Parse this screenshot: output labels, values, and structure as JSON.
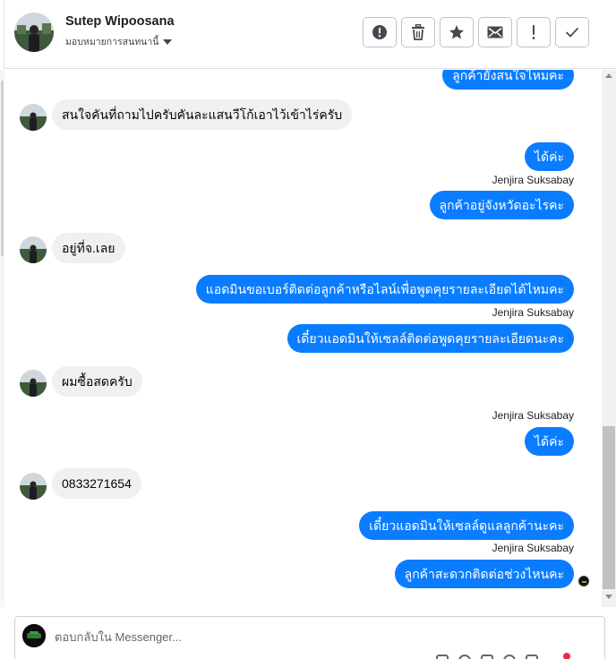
{
  "header": {
    "contact_name": "Sutep Wipoosana",
    "assign_label": "มอบหมายการสนทนานี้"
  },
  "actions": [
    {
      "icon": "alert-circle-icon"
    },
    {
      "icon": "trash-icon"
    },
    {
      "icon": "star-icon"
    },
    {
      "icon": "mail-icon"
    },
    {
      "icon": "exclamation-icon"
    },
    {
      "icon": "check-icon"
    }
  ],
  "messages": [
    {
      "dir": "out",
      "text": "ลูกค้ายังสนใจไหมคะ"
    },
    {
      "dir": "in",
      "text": "สนใจคันที่ถามไปครับคันละแสนวีโก้เอาไว้เข้าไร่ครับ"
    },
    {
      "dir": "out",
      "text": "ได้ค่ะ"
    },
    {
      "dir": "out",
      "sender": "Jenjira Suksabay",
      "text": "ลูกค้าอยู่จังหวัดอะไรคะ"
    },
    {
      "dir": "in",
      "text": "อยู่ที่จ.เลย"
    },
    {
      "dir": "out",
      "text": "แอดมินขอเบอร์ติดต่อลูกค้าหรือไลน์เพื่อพูดคุยรายละเอียดได้ไหมคะ"
    },
    {
      "dir": "out",
      "sender": "Jenjira Suksabay",
      "text": "เดี๋ยวแอดมินให้เซลล์ติดต่อพูดคุยรายละเอียดนะคะ"
    },
    {
      "dir": "in",
      "text": "ผมซื้อสดครับ"
    },
    {
      "dir": "out",
      "sender": "Jenjira Suksabay",
      "text": "ได้ค่ะ"
    },
    {
      "dir": "in",
      "text": "0833271654"
    },
    {
      "dir": "out",
      "text": "เดี๋ยวแอดมินให้เซลล์ดูแลลูกค้านะคะ"
    },
    {
      "dir": "out",
      "sender": "Jenjira Suksabay",
      "text": "ลูกค้าสะดวกติดต่อช่วงไหนคะ"
    }
  ],
  "composer": {
    "placeholder": "ตอบกลับใน Messenger..."
  },
  "colors": {
    "outgoing_bubble": "#0a7cff",
    "incoming_bubble": "#f0f0f0",
    "notification": "#f02849"
  }
}
